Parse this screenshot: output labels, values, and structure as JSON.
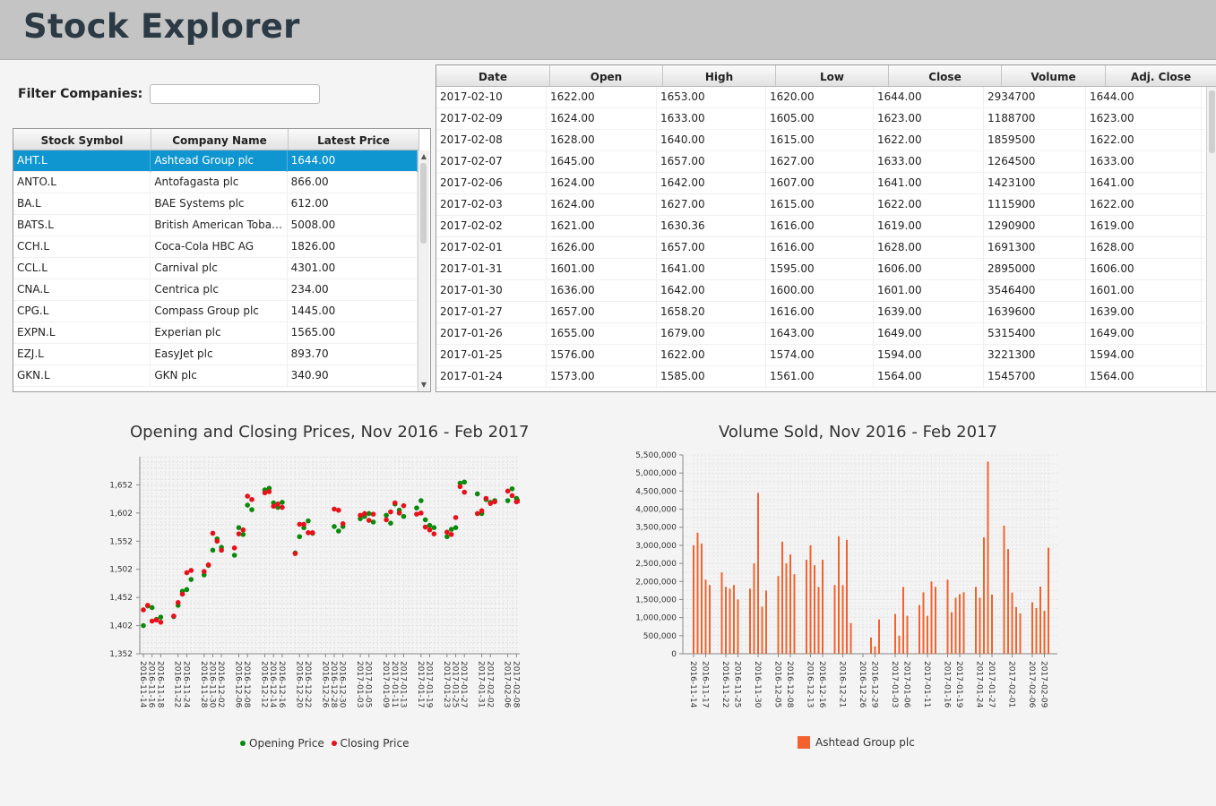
{
  "app": {
    "title": "Stock Explorer"
  },
  "filter": {
    "label": "Filter Companies:",
    "value": ""
  },
  "companies": {
    "columns": [
      "Stock Symbol",
      "Company Name",
      "Latest Price"
    ],
    "rows": [
      [
        "AHT.L",
        "Ashtead Group plc",
        "1644.00"
      ],
      [
        "ANTO.L",
        "Antofagasta plc",
        "866.00"
      ],
      [
        "BA.L",
        "BAE Systems plc",
        "612.00"
      ],
      [
        "BATS.L",
        "British American Tobacco ...",
        "5008.00"
      ],
      [
        "CCH.L",
        "Coca-Cola HBC AG",
        "1826.00"
      ],
      [
        "CCL.L",
        "Carnival plc",
        "4301.00"
      ],
      [
        "CNA.L",
        "Centrica plc",
        "234.00"
      ],
      [
        "CPG.L",
        "Compass Group plc",
        "1445.00"
      ],
      [
        "EXPN.L",
        "Experian plc",
        "1565.00"
      ],
      [
        "EZJ.L",
        "EasyJet plc",
        "893.70"
      ],
      [
        "GKN.L",
        "GKN plc",
        "340.90"
      ]
    ],
    "selected_row": 0
  },
  "prices": {
    "columns": [
      "Date",
      "Open",
      "High",
      "Low",
      "Close",
      "Volume",
      "Adj. Close"
    ],
    "rows": [
      [
        "2017-02-10",
        "1622.00",
        "1653.00",
        "1620.00",
        "1644.00",
        "2934700",
        "1644.00"
      ],
      [
        "2017-02-09",
        "1624.00",
        "1633.00",
        "1605.00",
        "1623.00",
        "1188700",
        "1623.00"
      ],
      [
        "2017-02-08",
        "1628.00",
        "1640.00",
        "1615.00",
        "1622.00",
        "1859500",
        "1622.00"
      ],
      [
        "2017-02-07",
        "1645.00",
        "1657.00",
        "1627.00",
        "1633.00",
        "1264500",
        "1633.00"
      ],
      [
        "2017-02-06",
        "1624.00",
        "1642.00",
        "1607.00",
        "1641.00",
        "1423100",
        "1641.00"
      ],
      [
        "2017-02-03",
        "1624.00",
        "1627.00",
        "1615.00",
        "1622.00",
        "1115900",
        "1622.00"
      ],
      [
        "2017-02-02",
        "1621.00",
        "1630.36",
        "1616.00",
        "1619.00",
        "1290900",
        "1619.00"
      ],
      [
        "2017-02-01",
        "1626.00",
        "1657.00",
        "1616.00",
        "1628.00",
        "1691300",
        "1628.00"
      ],
      [
        "2017-01-31",
        "1601.00",
        "1641.00",
        "1595.00",
        "1606.00",
        "2895000",
        "1606.00"
      ],
      [
        "2017-01-30",
        "1636.00",
        "1642.00",
        "1600.00",
        "1601.00",
        "3546400",
        "1601.00"
      ],
      [
        "2017-01-27",
        "1657.00",
        "1658.20",
        "1616.00",
        "1639.00",
        "1639600",
        "1639.00"
      ],
      [
        "2017-01-26",
        "1655.00",
        "1679.00",
        "1643.00",
        "1649.00",
        "5315400",
        "1649.00"
      ],
      [
        "2017-01-25",
        "1576.00",
        "1622.00",
        "1574.00",
        "1594.00",
        "3221300",
        "1594.00"
      ],
      [
        "2017-01-24",
        "1573.00",
        "1585.00",
        "1561.00",
        "1564.00",
        "1545700",
        "1564.00"
      ]
    ]
  },
  "chart_data": [
    {
      "type": "scatter",
      "title": "Opening and Closing Prices, Nov 2016 - Feb 2017",
      "xlabel": "",
      "ylabel": "",
      "ylim": [
        1352,
        1702
      ],
      "yticks": [
        1352,
        1402,
        1452,
        1502,
        1552,
        1602,
        1652
      ],
      "ytick_labels": [
        "1,352",
        "1,402",
        "1,452",
        "1,502",
        "1,552",
        "1,602",
        "1,652"
      ],
      "x": [
        "2016-11-14",
        "2016-11-15",
        "2016-11-16",
        "2016-11-17",
        "2016-11-18",
        "2016-11-21",
        "2016-11-22",
        "2016-11-23",
        "2016-11-24",
        "2016-11-25",
        "2016-11-28",
        "2016-11-29",
        "2016-11-30",
        "2016-12-01",
        "2016-12-02",
        "2016-12-05",
        "2016-12-06",
        "2016-12-07",
        "2016-12-08",
        "2016-12-09",
        "2016-12-12",
        "2016-12-13",
        "2016-12-14",
        "2016-12-15",
        "2016-12-16",
        "2016-12-19",
        "2016-12-20",
        "2016-12-21",
        "2016-12-22",
        "2016-12-23",
        "2016-12-28",
        "2016-12-29",
        "2016-12-30",
        "2017-01-03",
        "2017-01-04",
        "2017-01-05",
        "2017-01-06",
        "2017-01-09",
        "2017-01-10",
        "2017-01-11",
        "2017-01-12",
        "2017-01-13",
        "2017-01-16",
        "2017-01-17",
        "2017-01-18",
        "2017-01-19",
        "2017-01-20",
        "2017-01-23",
        "2017-01-24",
        "2017-01-25",
        "2017-01-26",
        "2017-01-27",
        "2017-01-30",
        "2017-01-31",
        "2017-02-01",
        "2017-02-02",
        "2017-02-03",
        "2017-02-06",
        "2017-02-07",
        "2017-02-08",
        "2017-02-09",
        "2017-02-10"
      ],
      "xtick_labels": [
        "2016-11-14",
        "2016-11-16",
        "2016-11-18",
        "2016-11-22",
        "2016-11-24",
        "2016-11-28",
        "2016-11-30",
        "2016-12-02",
        "2016-12-06",
        "2016-12-08",
        "2016-12-12",
        "2016-12-14",
        "2016-12-16",
        "2016-12-20",
        "2016-12-22",
        "2016-12-26",
        "2016-12-28",
        "2016-12-30",
        "2017-01-03",
        "2017-01-05",
        "2017-01-09",
        "2017-01-11",
        "2017-01-13",
        "2017-01-17",
        "2017-01-19",
        "2017-01-23",
        "2017-01-25",
        "2017-01-27",
        "2017-01-31",
        "2017-02-02",
        "2017-02-06",
        "2017-02-08",
        "2017-02-10"
      ],
      "series": [
        {
          "name": "Opening Price",
          "color": "#0a8a0a",
          "values": [
            1402,
            1437,
            1434,
            1413,
            1417,
            1418,
            1438,
            1463,
            1466,
            1484,
            1492,
            1509,
            1536,
            1556,
            1541,
            1527,
            1576,
            1564,
            1616,
            1608,
            1643,
            1646,
            1620,
            1612,
            1621,
            1531,
            1560,
            1576,
            1588,
            1566,
            1578,
            1570,
            1578,
            1592,
            1596,
            1601,
            1586,
            1598,
            1584,
            1618,
            1607,
            1596,
            1611,
            1624,
            1590,
            1580,
            1576,
            1560,
            1573,
            1576,
            1655,
            1657,
            1636,
            1601,
            1626,
            1621,
            1624,
            1624,
            1645,
            1628,
            1624,
            1622
          ]
        },
        {
          "name": "Closing Price",
          "color": "#e8101a",
          "values": [
            1430,
            1438,
            1410,
            1412,
            1408,
            1419,
            1443,
            1458,
            1496,
            1500,
            1498,
            1510,
            1566,
            1552,
            1536,
            1540,
            1565,
            1572,
            1632,
            1626,
            1638,
            1640,
            1614,
            1618,
            1612,
            1530,
            1582,
            1582,
            1567,
            1567,
            1609,
            1607,
            1583,
            1598,
            1601,
            1589,
            1600,
            1590,
            1604,
            1620,
            1602,
            1615,
            1600,
            1602,
            1577,
            1572,
            1565,
            1568,
            1564,
            1594,
            1649,
            1639,
            1601,
            1606,
            1628,
            1619,
            1622,
            1641,
            1633,
            1622,
            1623,
            1644
          ]
        }
      ],
      "legend": "bottom",
      "grid": true
    },
    {
      "type": "bar",
      "title": "Volume Sold, Nov 2016 - Feb 2017",
      "xlabel": "",
      "ylabel": "",
      "ylim": [
        0,
        5500000
      ],
      "yticks": [
        0,
        500000,
        1000000,
        1500000,
        2000000,
        2500000,
        3000000,
        3500000,
        4000000,
        4500000,
        5000000,
        5500000
      ],
      "ytick_labels": [
        "0",
        "500,000",
        "1,000,000",
        "1,500,000",
        "2,000,000",
        "2,500,000",
        "3,000,000",
        "3,500,000",
        "4,000,000",
        "4,500,000",
        "5,000,000",
        "5,500,000"
      ],
      "categories": [
        "2016-11-14",
        "2016-11-15",
        "2016-11-16",
        "2016-11-17",
        "2016-11-18",
        "2016-11-21",
        "2016-11-22",
        "2016-11-23",
        "2016-11-24",
        "2016-11-25",
        "2016-11-28",
        "2016-11-29",
        "2016-11-30",
        "2016-12-01",
        "2016-12-02",
        "2016-12-05",
        "2016-12-06",
        "2016-12-07",
        "2016-12-08",
        "2016-12-09",
        "2016-12-12",
        "2016-12-13",
        "2016-12-14",
        "2016-12-15",
        "2016-12-16",
        "2016-12-19",
        "2016-12-20",
        "2016-12-21",
        "2016-12-22",
        "2016-12-23",
        "2016-12-28",
        "2016-12-29",
        "2016-12-30",
        "2017-01-03",
        "2017-01-04",
        "2017-01-05",
        "2017-01-06",
        "2017-01-09",
        "2017-01-10",
        "2017-01-11",
        "2017-01-12",
        "2017-01-13",
        "2017-01-16",
        "2017-01-17",
        "2017-01-18",
        "2017-01-19",
        "2017-01-20",
        "2017-01-23",
        "2017-01-24",
        "2017-01-25",
        "2017-01-26",
        "2017-01-27",
        "2017-01-30",
        "2017-01-31",
        "2017-02-01",
        "2017-02-02",
        "2017-02-03",
        "2017-02-06",
        "2017-02-07",
        "2017-02-08",
        "2017-02-09",
        "2017-02-10"
      ],
      "xtick_labels": [
        "2016-11-14",
        "2016-11-17",
        "2016-11-22",
        "2016-11-25",
        "2016-11-30",
        "2016-12-05",
        "2016-12-08",
        "2016-12-13",
        "2016-12-16",
        "2016-12-21",
        "2016-12-26",
        "2016-12-29",
        "2017-01-03",
        "2017-01-06",
        "2017-01-11",
        "2017-01-16",
        "2017-01-19",
        "2017-01-24",
        "2017-01-27",
        "2017-02-01",
        "2017-02-06",
        "2017-02-09"
      ],
      "series": [
        {
          "name": "Ashtead Group plc",
          "color": "#f3622d",
          "values": [
            3000000,
            3350000,
            3050000,
            2050000,
            1900000,
            2250000,
            1850000,
            1800000,
            1900000,
            1500000,
            1800000,
            2500000,
            4450000,
            1300000,
            1750000,
            2150000,
            3100000,
            2500000,
            2750000,
            2200000,
            2600000,
            3000000,
            2450000,
            1850000,
            2600000,
            1900000,
            3250000,
            1900000,
            3150000,
            850000,
            450000,
            200000,
            950000,
            1100000,
            500000,
            1850000,
            1050000,
            1350000,
            1700000,
            1050000,
            2000000,
            1850000,
            2050000,
            1150000,
            1550000,
            1650000,
            1700000,
            1850000,
            1550000,
            3221300,
            5315400,
            1639600,
            3546400,
            2895000,
            1691300,
            1290900,
            1115900,
            1423100,
            1264500,
            1859500,
            1188700,
            2934700
          ]
        }
      ],
      "legend": "bottom",
      "grid": true
    }
  ]
}
